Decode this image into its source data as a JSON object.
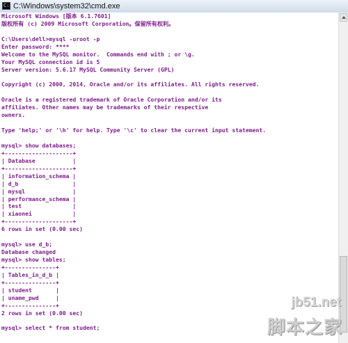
{
  "window": {
    "title": "C:\\Windows\\system32\\cmd.exe",
    "icon": "cmd-icon"
  },
  "console": {
    "text_color": "#7d1d8a",
    "background": "#ffffff",
    "lines": [
      "Microsoft Windows [版本 6.1.7601]",
      "版权所有 (c) 2009 Microsoft Corporation。保留所有权利。",
      "",
      "C:\\Users\\dell>mysql -uroot -p",
      "Enter password: ****",
      "Welcome to the MySQL monitor.  Commands end with ; or \\g.",
      "Your MySQL connection id is 5",
      "Server version: 5.6.17 MySQL Community Server (GPL)",
      "",
      "Copyright (c) 2000, 2014, Oracle and/or its affiliates. All rights reserved.",
      "",
      "Oracle is a registered trademark of Oracle Corporation and/or its",
      "affiliates. Other names may be trademarks of their respective",
      "owners.",
      "",
      "Type 'help;' or '\\h' for help. Type '\\c' to clear the current input statement.",
      "",
      "mysql> show databases;",
      "+--------------------+",
      "| Database           |",
      "+--------------------+",
      "| information_schema |",
      "| d_b                |",
      "| mysql              |",
      "| performance_schema |",
      "| test               |",
      "| xiaonei            |",
      "+--------------------+",
      "6 rows in set (0.00 sec)",
      "",
      "mysql> use d_b;",
      "Database changed",
      "mysql> show tables;",
      "+---------------+",
      "| Tables_in_d_b |",
      "+---------------+",
      "| student       |",
      "| uname_pwd     |",
      "+---------------+",
      "2 rows in set (0.00 sec)",
      "",
      "mysql> select * from student;"
    ]
  },
  "watermark": {
    "url": "jb51.net",
    "name": "脚本之家"
  }
}
